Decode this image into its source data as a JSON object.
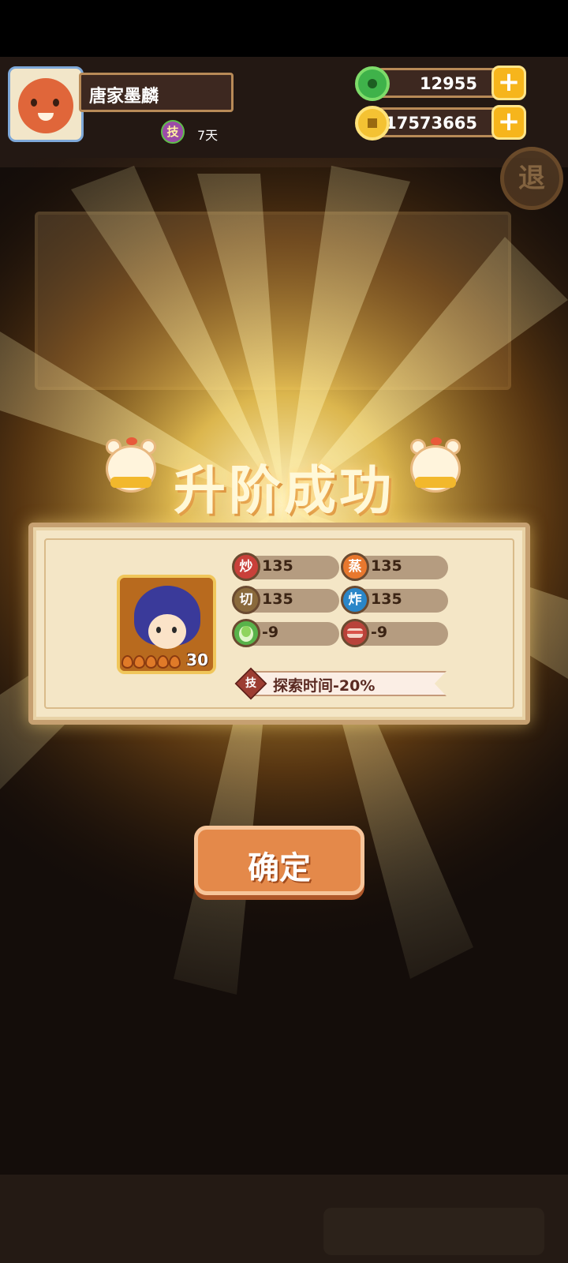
{
  "header": {
    "player_name": "唐家墨麟",
    "skill_badge": "技",
    "skill_days": "7天",
    "jade_amount": "12955",
    "coin_amount": "17573665",
    "plus": "+",
    "retreat_label": "退"
  },
  "dialog": {
    "title": "升阶成功",
    "character": {
      "level": "30",
      "stars": 5
    },
    "stats": [
      {
        "icon": "炒",
        "value": "135",
        "color": "#c9403a"
      },
      {
        "icon": "蒸",
        "value": "135",
        "color": "#e8782e"
      },
      {
        "icon": "切",
        "value": "135",
        "color": "#8a6a3c"
      },
      {
        "icon": "炸",
        "value": "135",
        "color": "#2a86c8"
      },
      {
        "icon": "",
        "value": "-9",
        "color": "#58b24a"
      },
      {
        "icon": "",
        "value": "-9",
        "color": "#b8433a"
      }
    ],
    "skill": {
      "tag": "技",
      "description": "探索时间-20%"
    },
    "confirm_label": "确定"
  }
}
